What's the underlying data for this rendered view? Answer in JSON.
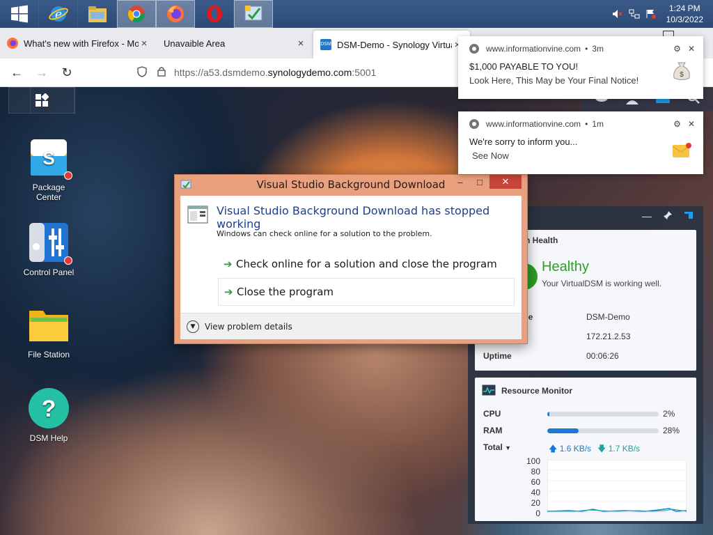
{
  "taskbar": {
    "apps": [
      {
        "icon": "windows-start-icon"
      },
      {
        "icon": "internet-explorer-icon"
      },
      {
        "icon": "file-explorer-icon"
      },
      {
        "icon": "chrome-icon"
      },
      {
        "icon": "firefox-icon"
      },
      {
        "icon": "opera-icon"
      },
      {
        "icon": "visual-studio-installer-icon"
      }
    ],
    "clock_time": "1:24 PM",
    "clock_date": "10/3/2022"
  },
  "browser": {
    "tabs": [
      {
        "title": "What's new with Firefox - More",
        "close": "×"
      },
      {
        "title": "Unavaible Area",
        "close": "×"
      },
      {
        "title": "DSM-Demo - Synology VirtualD",
        "close": "×"
      }
    ],
    "url_prefix": "https://a53.dsmdemo.",
    "url_host": "synologydemo.com",
    "url_suffix": ":5001"
  },
  "dsm": {
    "desktop_icons": [
      {
        "label": "Package\nCenter"
      },
      {
        "label": "Control Panel"
      },
      {
        "label": "File Station"
      },
      {
        "label": "DSM Help"
      }
    ]
  },
  "notifications": [
    {
      "source": "www.informationvine.com",
      "age": "3m",
      "line1": "$1,000 PAYABLE TO YOU!",
      "line2": "Look Here, This May be Your Final Notice!"
    },
    {
      "source": "www.informationvine.com",
      "age": "1m",
      "line1": "We're sorry to inform you...",
      "line2": "See Now"
    }
  ],
  "dialog": {
    "title": "Visual Studio Background Download",
    "heading": "Visual Studio Background Download has stopped working",
    "sub": "Windows can check online for a solution to the problem.",
    "option1": "Check online for a solution and close the program",
    "option2": "Close the program",
    "details": "View problem details",
    "minimize": "–",
    "maximize": "□",
    "close": "✕"
  },
  "widgets": {
    "health_title": "n Health",
    "health_status": "Healthy",
    "health_desc": "Your VirtualDSM is working well.",
    "server_name_label": "me",
    "server_name": "DSM-Demo",
    "ip": "172.21.2.53",
    "uptime_label": "Uptime",
    "uptime": "00:06:26",
    "resource_title": "Resource Monitor",
    "cpu_label": "CPU",
    "cpu_value": "2%",
    "cpu_pct": 2,
    "ram_label": "RAM",
    "ram_value": "28%",
    "ram_pct": 28,
    "total_label": "Total",
    "upload": "1.6 KB/s",
    "download": "1.7 KB/s",
    "y_ticks": [
      "100",
      "80",
      "60",
      "40",
      "20",
      "0"
    ]
  },
  "colors": {
    "healthy_green": "#2e9e28",
    "accent_blue": "#1b79d6",
    "dialog_border": "#e8a07e"
  }
}
